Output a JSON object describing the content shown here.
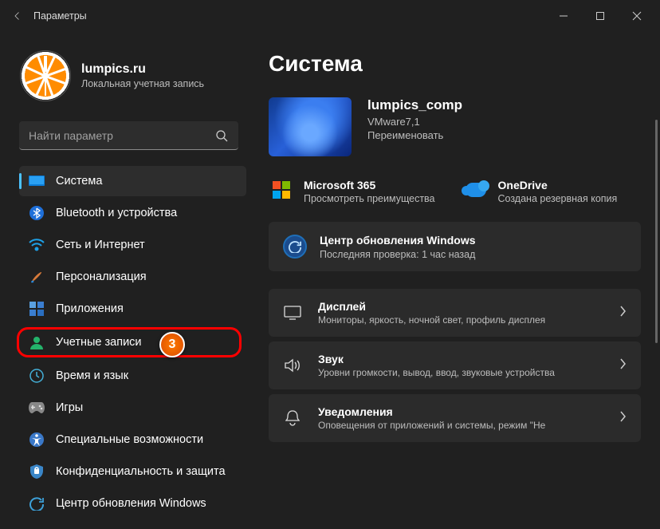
{
  "titlebar": {
    "title": "Параметры"
  },
  "user": {
    "name": "lumpics.ru",
    "sub": "Локальная учетная запись"
  },
  "search": {
    "placeholder": "Найти параметр"
  },
  "nav": [
    {
      "label": "Система"
    },
    {
      "label": "Bluetooth и устройства"
    },
    {
      "label": "Сеть и Интернет"
    },
    {
      "label": "Персонализация"
    },
    {
      "label": "Приложения"
    },
    {
      "label": "Учетные записи"
    },
    {
      "label": "Время и язык"
    },
    {
      "label": "Игры"
    },
    {
      "label": "Специальные возможности"
    },
    {
      "label": "Конфиденциальность и защита"
    },
    {
      "label": "Центр обновления Windows"
    }
  ],
  "annotation": {
    "badge": "3"
  },
  "main": {
    "heading": "Система",
    "pc": {
      "name": "lumpics_comp",
      "model": "VMware7,1",
      "rename": "Переименовать"
    },
    "ms365": {
      "title": "Microsoft 365",
      "sub": "Просмотреть преимущества"
    },
    "onedrive": {
      "title": "OneDrive",
      "sub": "Создана резервная копия"
    },
    "update": {
      "title": "Центр обновления Windows",
      "sub": "Последняя проверка: 1 час назад"
    },
    "cards": [
      {
        "title": "Дисплей",
        "sub": "Мониторы, яркость, ночной свет, профиль дисплея"
      },
      {
        "title": "Звук",
        "sub": "Уровни громкости, вывод, ввод, звуковые устройства"
      },
      {
        "title": "Уведомления",
        "sub": "Оповещения от приложений и системы, режим \"Не"
      }
    ]
  }
}
